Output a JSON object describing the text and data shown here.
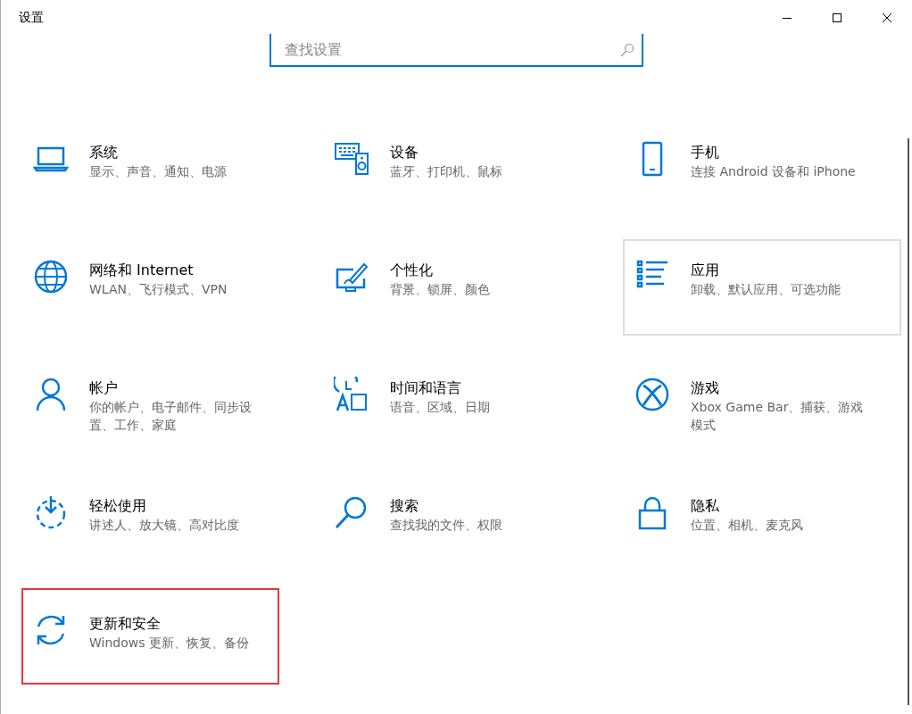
{
  "window": {
    "title": "设置"
  },
  "search": {
    "placeholder": "查找设置"
  },
  "tiles": [
    {
      "kind": "system",
      "title": "系统",
      "subtitle": "显示、声音、通知、电源",
      "hovered": false,
      "highlighted": false
    },
    {
      "kind": "devices",
      "title": "设备",
      "subtitle": "蓝牙、打印机、鼠标",
      "hovered": false,
      "highlighted": false
    },
    {
      "kind": "phone",
      "title": "手机",
      "subtitle": "连接 Android 设备和 iPhone",
      "hovered": false,
      "highlighted": false
    },
    {
      "kind": "network",
      "title": "网络和 Internet",
      "subtitle": "WLAN、飞行模式、VPN",
      "hovered": false,
      "highlighted": false
    },
    {
      "kind": "personalization",
      "title": "个性化",
      "subtitle": "背景、锁屏、颜色",
      "hovered": false,
      "highlighted": false
    },
    {
      "kind": "apps",
      "title": "应用",
      "subtitle": "卸载、默认应用、可选功能",
      "hovered": true,
      "highlighted": false
    },
    {
      "kind": "accounts",
      "title": "帐户",
      "subtitle": "你的帐户、电子邮件、同步设置、工作、家庭",
      "hovered": false,
      "highlighted": false
    },
    {
      "kind": "time",
      "title": "时间和语言",
      "subtitle": "语音、区域、日期",
      "hovered": false,
      "highlighted": false
    },
    {
      "kind": "gaming",
      "title": "游戏",
      "subtitle": "Xbox Game Bar、捕获、游戏模式",
      "hovered": false,
      "highlighted": false
    },
    {
      "kind": "ease",
      "title": "轻松使用",
      "subtitle": "讲述人、放大镜、高对比度",
      "hovered": false,
      "highlighted": false
    },
    {
      "kind": "search",
      "title": "搜索",
      "subtitle": "查找我的文件、权限",
      "hovered": false,
      "highlighted": false
    },
    {
      "kind": "privacy",
      "title": "隐私",
      "subtitle": "位置、相机、麦克风",
      "hovered": false,
      "highlighted": false
    },
    {
      "kind": "update",
      "title": "更新和安全",
      "subtitle": "Windows 更新、恢复、备份",
      "hovered": false,
      "highlighted": true
    }
  ]
}
